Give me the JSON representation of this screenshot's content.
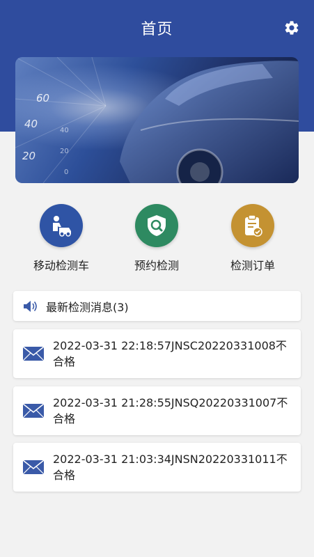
{
  "header": {
    "title": "首页",
    "settings_icon": "gear-icon"
  },
  "banner": {
    "speedometer_numbers": [
      "60",
      "40",
      "20",
      "40",
      "20",
      "0"
    ]
  },
  "quick_actions": [
    {
      "label": "移动检测车",
      "icon": "mobile-inspection-icon",
      "color": "#2f54a5"
    },
    {
      "label": "预约检测",
      "icon": "appointment-search-icon",
      "color": "#2e8a61"
    },
    {
      "label": "检测订单",
      "icon": "order-clipboard-icon",
      "color": "#c49232"
    }
  ],
  "news": {
    "title": "最新检测消息(3)",
    "items": [
      {
        "text": "2022-03-31 22:18:57JNSC20220331008不合格"
      },
      {
        "text": "2022-03-31 21:28:55JNSQ20220331007不合格"
      },
      {
        "text": "2022-03-31 21:03:34JNSN20220331011不合格"
      }
    ]
  },
  "colors": {
    "primary": "#2f4c9e",
    "background": "#f2f2f2"
  }
}
